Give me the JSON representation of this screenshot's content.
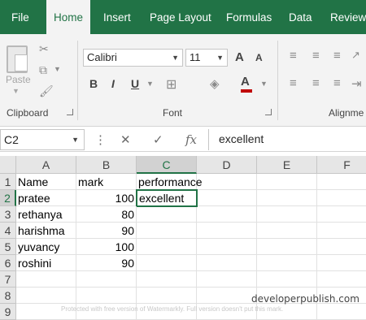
{
  "tabs": [
    {
      "label": "File",
      "active": false
    },
    {
      "label": "Home",
      "active": true
    },
    {
      "label": "Insert",
      "active": false
    },
    {
      "label": "Page Layout",
      "active": false
    },
    {
      "label": "Formulas",
      "active": false
    },
    {
      "label": "Data",
      "active": false
    },
    {
      "label": "Review",
      "active": false
    }
  ],
  "ribbon": {
    "clipboard": {
      "paste_label": "Paste",
      "group_label": "Clipboard"
    },
    "font": {
      "font_name": "Calibri",
      "font_size": "11",
      "bold": "B",
      "italic": "I",
      "underline": "U",
      "grow": "A",
      "shrink": "A",
      "font_color_letter": "A",
      "group_label": "Font"
    },
    "alignment": {
      "group_label": "Alignme"
    }
  },
  "formula_bar": {
    "name_box": "C2",
    "cancel": "✕",
    "enter": "✓",
    "fx": "fx",
    "formula": "excellent"
  },
  "grid": {
    "columns": [
      "A",
      "B",
      "C",
      "D",
      "E",
      "F"
    ],
    "rows": [
      "1",
      "2",
      "3",
      "4",
      "5",
      "6",
      "7",
      "8",
      "9"
    ],
    "cells": [
      [
        "Name",
        "mark",
        "performance"
      ],
      [
        "pratee",
        "100",
        "excellent"
      ],
      [
        "rethanya",
        "80",
        ""
      ],
      [
        "harishma",
        "90",
        ""
      ],
      [
        "yuvancy",
        "100",
        ""
      ],
      [
        "roshini",
        "90",
        ""
      ]
    ]
  },
  "watermark": "developerpublish.com",
  "footnote": "Protected with free version of Watermarkly. Full version doesn't put this mark."
}
